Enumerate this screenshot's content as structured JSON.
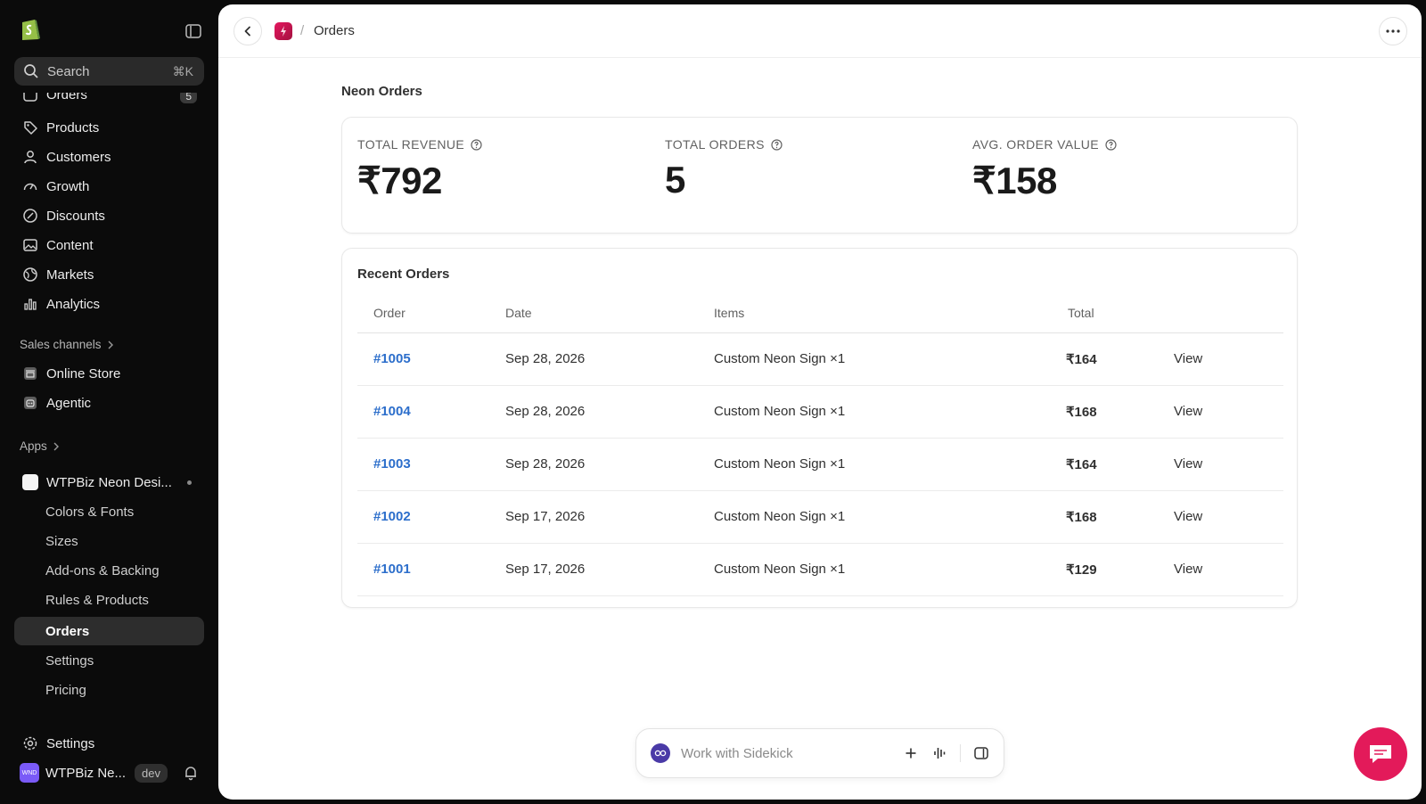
{
  "sidebar": {
    "search": {
      "placeholder": "Search",
      "shortcut": "⌘K"
    },
    "nav": [
      {
        "label": "Orders",
        "badge": "5",
        "icon": "inbox-icon"
      },
      {
        "label": "Products",
        "icon": "tag-icon"
      },
      {
        "label": "Customers",
        "icon": "person-icon"
      },
      {
        "label": "Growth",
        "icon": "gauge-icon"
      },
      {
        "label": "Discounts",
        "icon": "discount-icon"
      },
      {
        "label": "Content",
        "icon": "image-icon"
      },
      {
        "label": "Markets",
        "icon": "globe-icon"
      },
      {
        "label": "Analytics",
        "icon": "bar-chart-icon"
      }
    ],
    "sales_channels": {
      "title": "Sales channels",
      "items": [
        {
          "label": "Online Store",
          "icon": "store-icon"
        },
        {
          "label": "Agentic",
          "icon": "robot-icon"
        }
      ]
    },
    "apps": {
      "title": "Apps",
      "app_name": "WTPBiz Neon Desi...",
      "sub_items": [
        {
          "label": "Colors & Fonts"
        },
        {
          "label": "Sizes"
        },
        {
          "label": "Add-ons & Backing"
        },
        {
          "label": "Rules & Products"
        },
        {
          "label": "Orders"
        },
        {
          "label": "Settings"
        },
        {
          "label": "Pricing"
        }
      ]
    },
    "settings_label": "Settings",
    "store": {
      "avatar_text": "WND",
      "name": "WTPBiz Ne...",
      "badge": "dev"
    }
  },
  "header": {
    "title": "Orders"
  },
  "page": {
    "heading": "Neon Orders"
  },
  "stats": [
    {
      "label": "TOTAL REVENUE",
      "value": "₹792"
    },
    {
      "label": "TOTAL ORDERS",
      "value": "5"
    },
    {
      "label": "AVG. ORDER VALUE",
      "value": "₹158"
    }
  ],
  "recent_orders": {
    "title": "Recent Orders",
    "columns": [
      "Order",
      "Date",
      "Items",
      "Total"
    ],
    "rows": [
      {
        "order": "#1005",
        "date": "Sep 28, 2026",
        "items": "Custom Neon Sign ×1",
        "total": "₹164",
        "action": "View"
      },
      {
        "order": "#1004",
        "date": "Sep 28, 2026",
        "items": "Custom Neon Sign ×1",
        "total": "₹168",
        "action": "View"
      },
      {
        "order": "#1003",
        "date": "Sep 28, 2026",
        "items": "Custom Neon Sign ×1",
        "total": "₹164",
        "action": "View"
      },
      {
        "order": "#1002",
        "date": "Sep 17, 2026",
        "items": "Custom Neon Sign ×1",
        "total": "₹168",
        "action": "View"
      },
      {
        "order": "#1001",
        "date": "Sep 17, 2026",
        "items": "Custom Neon Sign ×1",
        "total": "₹129",
        "action": "View"
      }
    ]
  },
  "sidekick": {
    "placeholder": "Work with Sidekick"
  },
  "colors": {
    "brand_green": "#95bf47",
    "link_blue": "#2c6ecb",
    "accent_pink": "#e31a5a"
  }
}
